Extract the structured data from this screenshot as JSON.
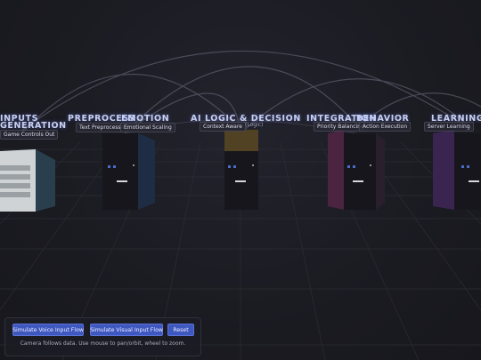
{
  "modules": [
    {
      "title": "INPUTS",
      "sub": "Game Controls Out",
      "color": "#2a3f4e"
    },
    {
      "title": "GENERATION",
      "sub": "",
      "color": "#2a3f4e"
    },
    {
      "title": "PREPROCESS",
      "sub": "Text Preprocessing",
      "color": "#1f2d44"
    },
    {
      "title": "EMOTION",
      "sub": "Emotional Scaling",
      "color": "#1f2d44"
    },
    {
      "title": "AI LOGIC & DECISION",
      "sub": "Context Aware",
      "sub2": "(Logic)",
      "color": "#5a4a24"
    },
    {
      "title": "INTEGRATION",
      "sub": "Priority Balancing",
      "color": "#4a2440"
    },
    {
      "title": "BEHAVIOR",
      "sub": "Action Execution",
      "color": "#4a2440"
    },
    {
      "title": "LEARNING",
      "sub": "Server Learning",
      "color": "#3a2450"
    }
  ],
  "controls": {
    "voice_button": "Simulate Voice Input Flow",
    "visual_button": "Simulate Visual Input Flow",
    "reset_button": "Reset",
    "hint": "Camera follows data. Use mouse to pan/orbit, wheel to zoom."
  },
  "colors": {
    "accent": "#3f58bf",
    "background": "#1b1b22"
  }
}
